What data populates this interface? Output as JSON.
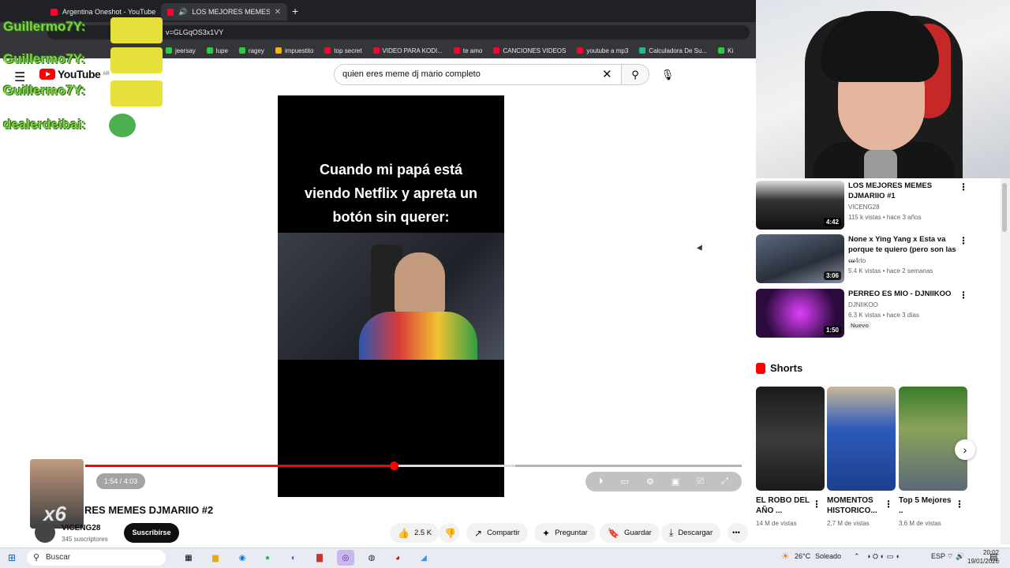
{
  "browser": {
    "tabs": [
      {
        "label": "Argentina Oneshot - YouTube",
        "active": false
      },
      {
        "label": "LOS MEJORES MEMES DJMAR",
        "active": true
      }
    ],
    "url": "v=GLGqOS3x1VY",
    "bookmarks": [
      {
        "label": "jeersay",
        "color": "#2ecc40"
      },
      {
        "label": "lupe",
        "color": "#2ecc40"
      },
      {
        "label": "ragey",
        "color": "#2ecc40"
      },
      {
        "label": "impuestito",
        "color": "#f4b400"
      },
      {
        "label": "top secret",
        "color": "#ff0033"
      },
      {
        "label": "VIDEO PARA KODI...",
        "color": "#ff0033"
      },
      {
        "label": "te amo",
        "color": "#ff0033"
      },
      {
        "label": "CANCIONES VIDEOS",
        "color": "#ff0033"
      },
      {
        "label": "youtube a mp3",
        "color": "#ff0033"
      },
      {
        "label": "Calculadora De Su...",
        "color": "#1abc9c"
      },
      {
        "label": "Ki",
        "color": "#2ecc40"
      }
    ]
  },
  "chat": [
    {
      "user": "Guillermo7Y:"
    },
    {
      "user": "Guillermo7Y:"
    },
    {
      "user": "Guillermo7Y:"
    },
    {
      "user": "dealerdeibai:"
    }
  ],
  "youtube": {
    "logo_text": "YouTube",
    "logo_region": "AR",
    "search_value": "quien eres meme dj mario completo"
  },
  "video": {
    "caption_lines": [
      "Cuando mi papá está",
      "viendo Netflix y apreta un",
      "botón sin querer:"
    ],
    "time": "1:54 / 4:03",
    "progress_fraction": 0.47,
    "title": "RES MEMES DJMARIIO #2",
    "overlay_text": "x6",
    "channel": "VICENG28",
    "subscribers": "345 suscriptores",
    "subscribe_label": "Suscribirse",
    "likes": "2.5 K",
    "actions": {
      "share": "Compartir",
      "ask": "Preguntar",
      "save": "Guardar",
      "download": "Descargar"
    }
  },
  "related": [
    {
      "title": "LOS MEJORES MEMES DJMARIIO #1",
      "channel": "VICENG28",
      "meta": "115 k vistas • hace 3 años",
      "duration": "4:42"
    },
    {
      "title": "None x Ying Yang x Esta va porque te quiero (pero son las ...",
      "channel": "cu4rto",
      "meta": "5.4 K vistas • hace 2 semanas",
      "duration": "3:06"
    },
    {
      "title": "PERREO ES MIO - DJNIIKOO",
      "channel": "DJNIIKOO",
      "meta": "6.3 K vistas • hace 3 días",
      "duration": "1:50",
      "badge": "Nuevo"
    }
  ],
  "shorts": {
    "heading": "Shorts",
    "items": [
      {
        "title": "EL ROBO DEL AÑO ...",
        "views": "14 M de vistas"
      },
      {
        "title": "MOMENTOS HISTORICO...",
        "views": "2,7 M de vistas"
      },
      {
        "title": "Top 5 Mejores ..",
        "views": "3.6 M de vistas"
      }
    ]
  },
  "taskbar": {
    "search_placeholder": "Buscar",
    "weather": "26°C",
    "weather_desc": "Soleado",
    "lang": "ESP",
    "time": "20:02",
    "date": "19/01/2026"
  }
}
